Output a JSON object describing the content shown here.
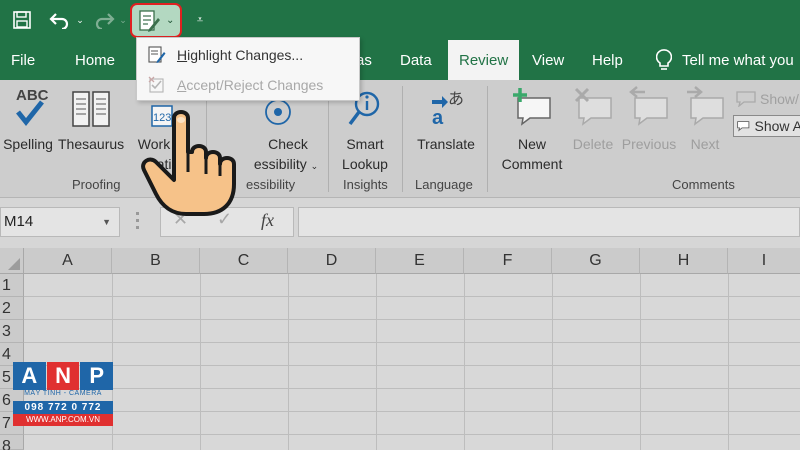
{
  "qat": {
    "save_icon": "save-icon",
    "undo_icon": "undo-icon",
    "redo_icon": "redo-icon",
    "track_changes_icon": "track-changes-icon",
    "customize_icon": "customize-qat-icon"
  },
  "tabs": [
    {
      "label": "File"
    },
    {
      "label": "Home"
    },
    {
      "label": "as"
    },
    {
      "label": "Data"
    },
    {
      "label": "Review",
      "active": true
    },
    {
      "label": "View"
    },
    {
      "label": "Help"
    }
  ],
  "tell_me": "Tell me what you",
  "dropdown": {
    "items": [
      {
        "label_key": "H",
        "label_rest": "ighlight Changes...",
        "enabled": true
      },
      {
        "label_key": "A",
        "label_rest": "ccept/Reject Changes",
        "enabled": false
      }
    ]
  },
  "ribbon": {
    "proofing": {
      "spelling_icon_text": "ABC",
      "spelling": "Spelling",
      "thesaurus": "Thesaurus",
      "workbook_stats_1": "Work",
      "workbook_stats_2": "Statis",
      "workbook_stats_icon_text": "123",
      "group": "Proofing"
    },
    "accessibility": {
      "check_1": "Check",
      "check_2": "essibility",
      "group": "essibility"
    },
    "insights": {
      "smart_1": "Smart",
      "smart_2": "Lookup",
      "group": "Insights"
    },
    "language": {
      "translate": "Translate",
      "group": "Language"
    },
    "comments": {
      "new_1": "New",
      "new_2": "Comment",
      "delete": "Delete",
      "previous": "Previous",
      "next": "Next",
      "show_hide": "Show/",
      "show_all": "Show A",
      "group": "Comments"
    }
  },
  "formula_bar": {
    "name_box": "M14",
    "cancel": "✕",
    "enter": "✓",
    "fx": "fx",
    "value": ""
  },
  "grid": {
    "columns": [
      "A",
      "B",
      "C",
      "D",
      "E",
      "F",
      "G",
      "H",
      "I"
    ],
    "rows": [
      "1",
      "2",
      "3",
      "4",
      "5",
      "6",
      "7",
      "8"
    ]
  },
  "watermark": {
    "letters": [
      "A",
      "N",
      "P"
    ],
    "subtitle": "MÁY TÍNH - CAMERA",
    "phone": "098 772 0 772",
    "site": "WWW.ANP.COM.VN"
  },
  "colors": {
    "excel_green": "#217346",
    "highlight_red": "#e02020",
    "watermark_blue": "#1f66a8",
    "watermark_red": "#e03030"
  }
}
